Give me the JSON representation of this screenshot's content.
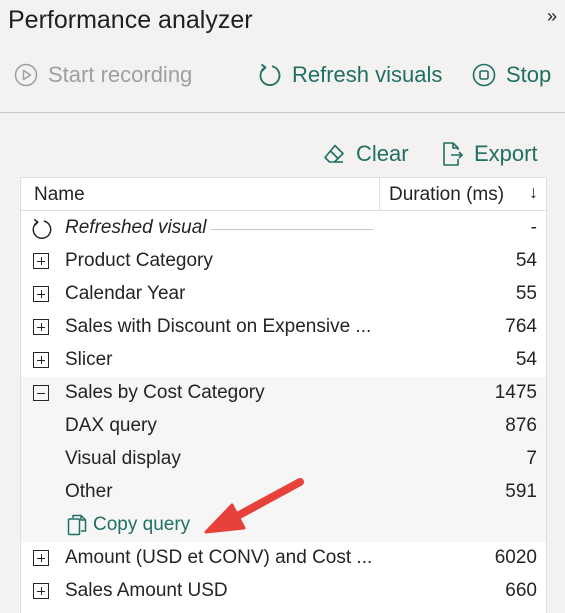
{
  "header": {
    "title": "Performance analyzer",
    "collapse_glyph": "»"
  },
  "toolbar": {
    "start_label": "Start recording",
    "refresh_label": "Refresh visuals",
    "stop_label": "Stop"
  },
  "actions": {
    "clear_label": "Clear",
    "export_label": "Export"
  },
  "table": {
    "columns": {
      "name": "Name",
      "duration": "Duration (ms)",
      "sort_glyph": "↓"
    },
    "rows": [
      {
        "name": "Refreshed visual",
        "duration": "-"
      },
      {
        "name": "Product Category",
        "duration": "54"
      },
      {
        "name": "Calendar Year",
        "duration": "55"
      },
      {
        "name": "Sales with Discount on Expensive ...",
        "duration": "764"
      },
      {
        "name": "Slicer",
        "duration": "54"
      },
      {
        "name": "Sales by Cost Category",
        "duration": "1475"
      },
      {
        "name": "DAX query",
        "duration": "876"
      },
      {
        "name": "Visual display",
        "duration": "7"
      },
      {
        "name": "Other",
        "duration": "591"
      },
      {
        "name": "Copy query",
        "duration": ""
      },
      {
        "name": "Amount (USD et CONV) and Cost ...",
        "duration": "6020"
      },
      {
        "name": "Sales Amount USD",
        "duration": "660"
      }
    ]
  },
  "colors": {
    "accent": "#1f6f64",
    "disabled": "#a19f9d",
    "annotation_arrow": "#e8413c"
  },
  "icons": [
    "play-circle-icon",
    "refresh-icon",
    "stop-icon",
    "eraser-icon",
    "export-icon",
    "copy-icon",
    "expand-icon",
    "collapse-icon",
    "sort-arrow-icon"
  ]
}
